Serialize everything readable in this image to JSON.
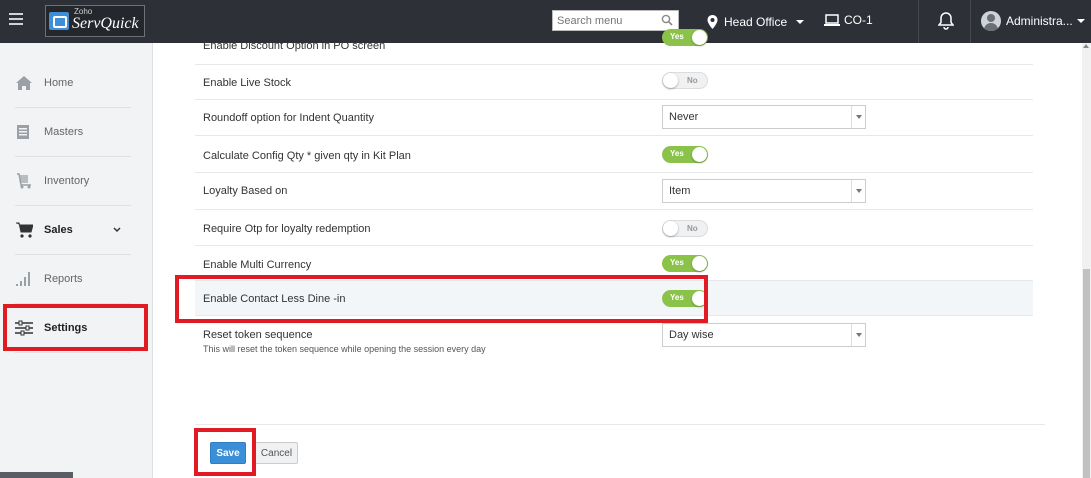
{
  "header": {
    "brand_small": "Zoho",
    "brand_name": "ServQuick",
    "search_placeholder": "Search menu",
    "location": "Head Office",
    "counter": "CO-1",
    "user": "Administra..."
  },
  "sidebar": {
    "items": [
      {
        "label": "Home",
        "icon": "home-icon"
      },
      {
        "label": "Masters",
        "icon": "masters-icon"
      },
      {
        "label": "Inventory",
        "icon": "inventory-icon"
      },
      {
        "label": "Sales",
        "icon": "cart-icon"
      },
      {
        "label": "Reports",
        "icon": "bar-chart-icon"
      },
      {
        "label": "Settings",
        "icon": "sliders-icon"
      }
    ]
  },
  "settings": {
    "rows": [
      {
        "label": "Enable Discount Option in PO screen",
        "control": "toggle",
        "value": "Yes"
      },
      {
        "label": "Enable Live Stock",
        "control": "toggle",
        "value": "No"
      },
      {
        "label": "Roundoff option for Indent Quantity",
        "control": "select",
        "value": "Never"
      },
      {
        "label": "Calculate Config Qty * given qty in Kit Plan",
        "control": "toggle",
        "value": "Yes"
      },
      {
        "label": "Loyalty Based on",
        "control": "select",
        "value": "Item"
      },
      {
        "label": "Require Otp for loyalty redemption",
        "control": "toggle",
        "value": "No"
      },
      {
        "label": "Enable Multi Currency",
        "control": "toggle",
        "value": "Yes"
      },
      {
        "label": "Enable Contact Less Dine -in",
        "control": "toggle",
        "value": "Yes"
      },
      {
        "label": "Reset token sequence",
        "sublabel": "This will reset the token sequence while opening the session every day",
        "control": "select",
        "value": "Day wise"
      }
    ]
  },
  "actions": {
    "save": "Save",
    "cancel": "Cancel"
  },
  "colors": {
    "topbar": "#2d3036",
    "toggle_on": "#8bc34a",
    "primary": "#3b8fd9",
    "highlight_box": "#e01b24"
  }
}
